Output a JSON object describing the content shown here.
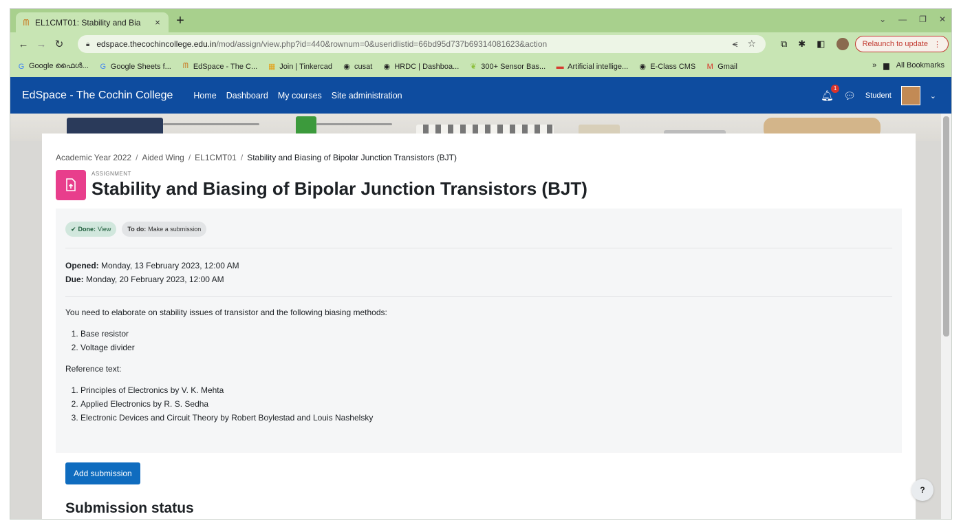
{
  "browser": {
    "tab_title": "EL1CMT01: Stability and Bia",
    "tab_close": "×",
    "new_tab": "+",
    "url_host": "edspace.thecochincollege.edu.in",
    "url_path": "/mod/assign/view.php?id=440&rownum=0&useridlistid=66bd95d737b69314081623&action",
    "relaunch_label": "Relaunch to update",
    "bookmarks": [
      {
        "label": "Google ഫൈൾ...",
        "icon": "google-icon"
      },
      {
        "label": "Google Sheets f...",
        "icon": "google-icon"
      },
      {
        "label": "EdSpace - The C...",
        "icon": "moodle-icon"
      },
      {
        "label": "Join | Tinkercad",
        "icon": "tinkercad-icon"
      },
      {
        "label": "cusat",
        "icon": "globe-icon"
      },
      {
        "label": "HRDC | Dashboa...",
        "icon": "globe-icon"
      },
      {
        "label": "300+ Sensor Bas...",
        "icon": "leaf-icon"
      },
      {
        "label": "Artificial intellige...",
        "icon": "flag-icon"
      },
      {
        "label": "E-Class CMS",
        "icon": "globe-icon"
      },
      {
        "label": "Gmail",
        "icon": "gmail-icon"
      }
    ],
    "all_bookmarks": "All Bookmarks"
  },
  "sitenav": {
    "brand": "EdSpace - The Cochin College",
    "links": [
      "Home",
      "Dashboard",
      "My courses",
      "Site administration"
    ],
    "notification_count": "1",
    "user_label": "Student"
  },
  "breadcrumb": {
    "items": [
      "Academic Year 2022",
      "Aided Wing",
      "EL1CMT01"
    ],
    "current": "Stability and Biasing of Bipolar Junction Transistors (BJT)",
    "separator": "/"
  },
  "page": {
    "module_type": "ASSIGNMENT",
    "title": "Stability and Biasing of Bipolar Junction Transistors (BJT)"
  },
  "completion": {
    "done_label": "Done:",
    "done_value": "View",
    "todo_label": "To do:",
    "todo_value": "Make a submission"
  },
  "dates": {
    "opened_label": "Opened:",
    "opened_value": "Monday, 13 February 2023, 12:00 AM",
    "due_label": "Due:",
    "due_value": "Monday, 20 February 2023, 12:00 AM"
  },
  "intro": {
    "lead": "You need to elaborate on stability issues of transistor and the following biasing methods:",
    "methods": [
      "Base resistor",
      "Voltage divider"
    ],
    "reference_label": "Reference text:",
    "references": [
      "Principles of Electronics by V. K. Mehta",
      "Applied Electronics by R. S. Sedha",
      "Electronic Devices and Circuit Theory by Robert Boylestad and Louis Nashelsky"
    ]
  },
  "actions": {
    "add_submission": "Add submission",
    "help": "?"
  },
  "submission_status": {
    "heading": "Submission status"
  },
  "colors": {
    "browser_green": "#a8d08d",
    "navbar_blue": "#0e4c9f",
    "primary_button": "#0f6cbf",
    "assignment_icon": "#e83e8c"
  }
}
